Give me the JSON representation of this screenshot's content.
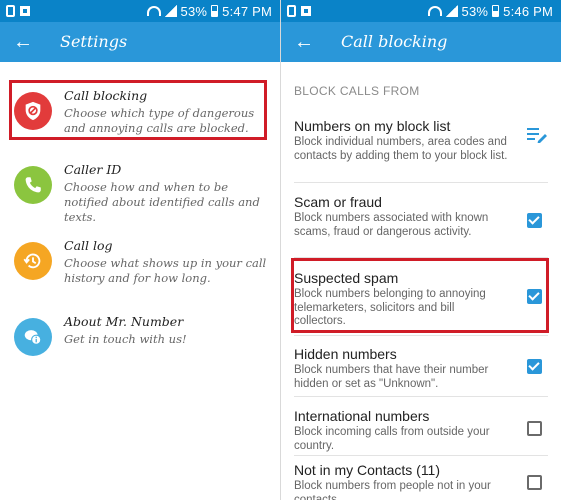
{
  "colors": {
    "statusbar": "#0a83c8",
    "appbar": "#2a97d9",
    "highlight": "#d01c27",
    "call_blocking_icon": "#e23b3b",
    "caller_id_icon": "#8bc53f",
    "call_log_icon": "#f5a623",
    "about_icon": "#47b0e0",
    "checkbox_on": "#2a97d9"
  },
  "left": {
    "status": {
      "battery": "53%",
      "time": "5:47 PM"
    },
    "title": "Settings",
    "items": [
      {
        "title": "Call blocking",
        "desc": "Choose which type of dangerous and annoying calls are blocked.",
        "icon": "shield-block-icon"
      },
      {
        "title": "Caller ID",
        "desc": "Choose how and when to be notified about identified calls and texts.",
        "icon": "phone-icon"
      },
      {
        "title": "Call log",
        "desc": "Choose what shows up in your call history and for how long.",
        "icon": "history-icon"
      },
      {
        "title": "About Mr. Number",
        "desc": "Get in touch with us!",
        "icon": "chat-info-icon"
      }
    ]
  },
  "right": {
    "status": {
      "battery": "53%",
      "time": "5:46 PM"
    },
    "title": "Call blocking",
    "section": "BLOCK CALLS FROM",
    "items": [
      {
        "title": "Numbers on my block list",
        "desc": "Block individual numbers, area codes and contacts by adding them to your block list.",
        "control": "edit-list-icon"
      },
      {
        "title": "Scam or fraud",
        "desc": "Block numbers associated with known scams, fraud or dangerous activity.",
        "checked": true
      },
      {
        "title": "Suspected spam",
        "desc": "Block numbers belonging to annoying telemarketers, solicitors and bill collectors.",
        "checked": true
      },
      {
        "title": "Hidden numbers",
        "desc": "Block numbers that have their number hidden or set as \"Unknown\".",
        "checked": true
      },
      {
        "title": "International numbers",
        "desc": "Block incoming calls from outside your country.",
        "checked": false
      },
      {
        "title": "Not in my Contacts (11)",
        "desc": "Block numbers from people not in your contacts.",
        "checked": false
      }
    ]
  }
}
